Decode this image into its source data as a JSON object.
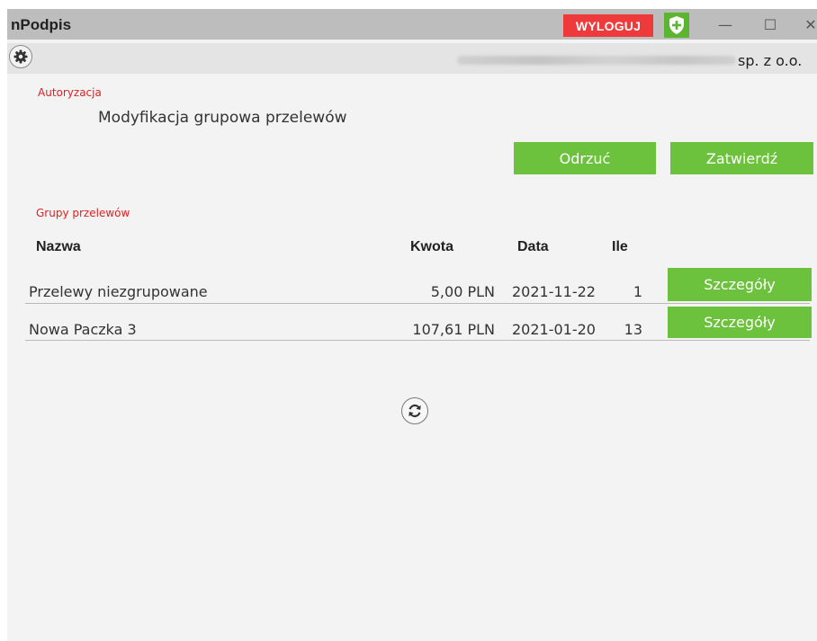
{
  "window": {
    "title": "nPodpis",
    "logout_label": "WYLOGUJ",
    "minimize_glyph": "—",
    "maximize_glyph": "☐",
    "close_glyph": "✕"
  },
  "toolbar": {
    "company_suffix": "sp. z o.o."
  },
  "authorization": {
    "section_label": "Autoryzacja",
    "title": "Modyfikacja grupowa przelewów",
    "reject_label": "Odrzuć",
    "confirm_label": "Zatwierdź"
  },
  "groups": {
    "section_label": "Grupy przelewów",
    "columns": [
      "Nazwa",
      "Kwota",
      "Data",
      "Ile"
    ],
    "rows": [
      {
        "name": "Przelewy niezgrupowane",
        "amount": "5,00 PLN",
        "date": "2021-11-22",
        "count": "1",
        "details_label": "Szczegóły"
      },
      {
        "name": "Nowa Paczka 3",
        "amount": "107,61 PLN",
        "date": "2021-01-20",
        "count": "13",
        "details_label": "Szczegóły"
      }
    ]
  },
  "colors": {
    "accent_green": "#6cc13d",
    "logout_red": "#ee3a3a",
    "section_label_red": "#e02020",
    "titlebar": "#bdbdbd"
  },
  "icons": [
    "gear-icon",
    "shield-icon",
    "refresh-icon"
  ]
}
